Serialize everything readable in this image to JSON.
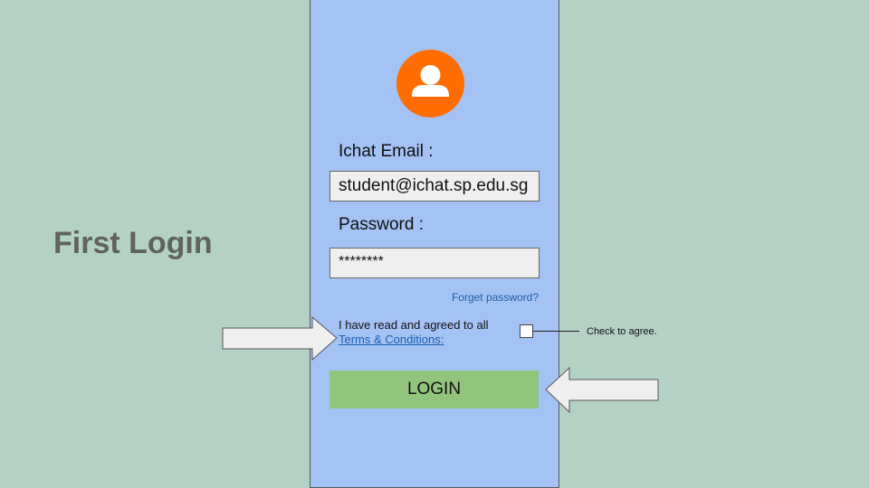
{
  "slide": {
    "title": "First Login"
  },
  "login_form": {
    "avatar_icon": "user-icon",
    "email_label": "Ichat Email :",
    "email_value": "student@ichat.sp.edu.sg",
    "password_label": "Password :",
    "password_value": "********",
    "forget_password_link": "Forget password?",
    "agree_text": "I have read and agreed to all",
    "terms_link": "Terms & Conditions:",
    "agree_checked": false,
    "login_button_label": "LOGIN"
  },
  "annotations": {
    "checkbox_callout": "Check to agree.",
    "arrow_icons": [
      "right-arrow-icon",
      "left-arrow-icon"
    ]
  },
  "colors": {
    "background": "#b3d2c5",
    "phone_panel": "#a4c2f4",
    "avatar": "#ff6d01",
    "login_button": "#93c47d",
    "link": "#1a5fb4",
    "title": "#5f635f"
  }
}
